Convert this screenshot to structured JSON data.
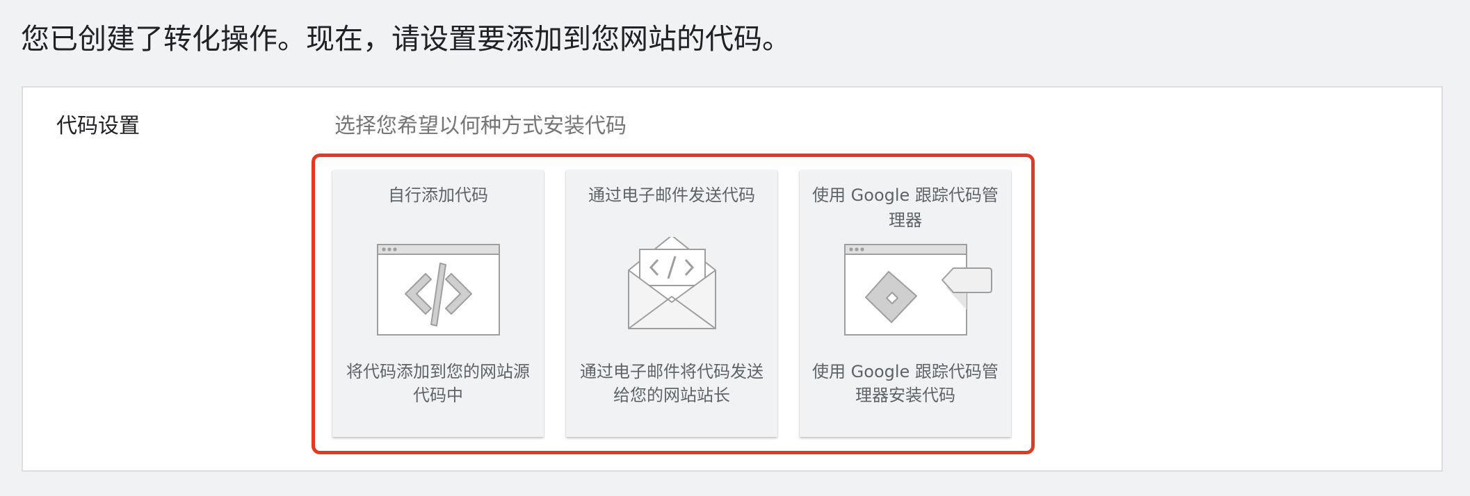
{
  "header": {
    "title": "您已创建了转化操作。现在，请设置要添加到您网站的代码。"
  },
  "panel": {
    "label": "代码设置",
    "hint": "选择您希望以何种方式安装代码",
    "options": [
      {
        "title": "自行添加代码",
        "description": "将代码添加到您的网站源代码中",
        "icon": "code-browser-icon"
      },
      {
        "title": "通过电子邮件发送代码",
        "description": "通过电子邮件将代码发送给您的网站站长",
        "icon": "email-code-icon"
      },
      {
        "title": "使用 Google 跟踪代码管理器",
        "description": "使用 Google 跟踪代码管理器安装代码",
        "icon": "tag-manager-icon"
      }
    ]
  },
  "colors": {
    "highlight": "#e03a25",
    "card_bg": "#f1f2f4",
    "panel_bg": "#ffffff",
    "icon_stroke": "#9e9e9e"
  }
}
